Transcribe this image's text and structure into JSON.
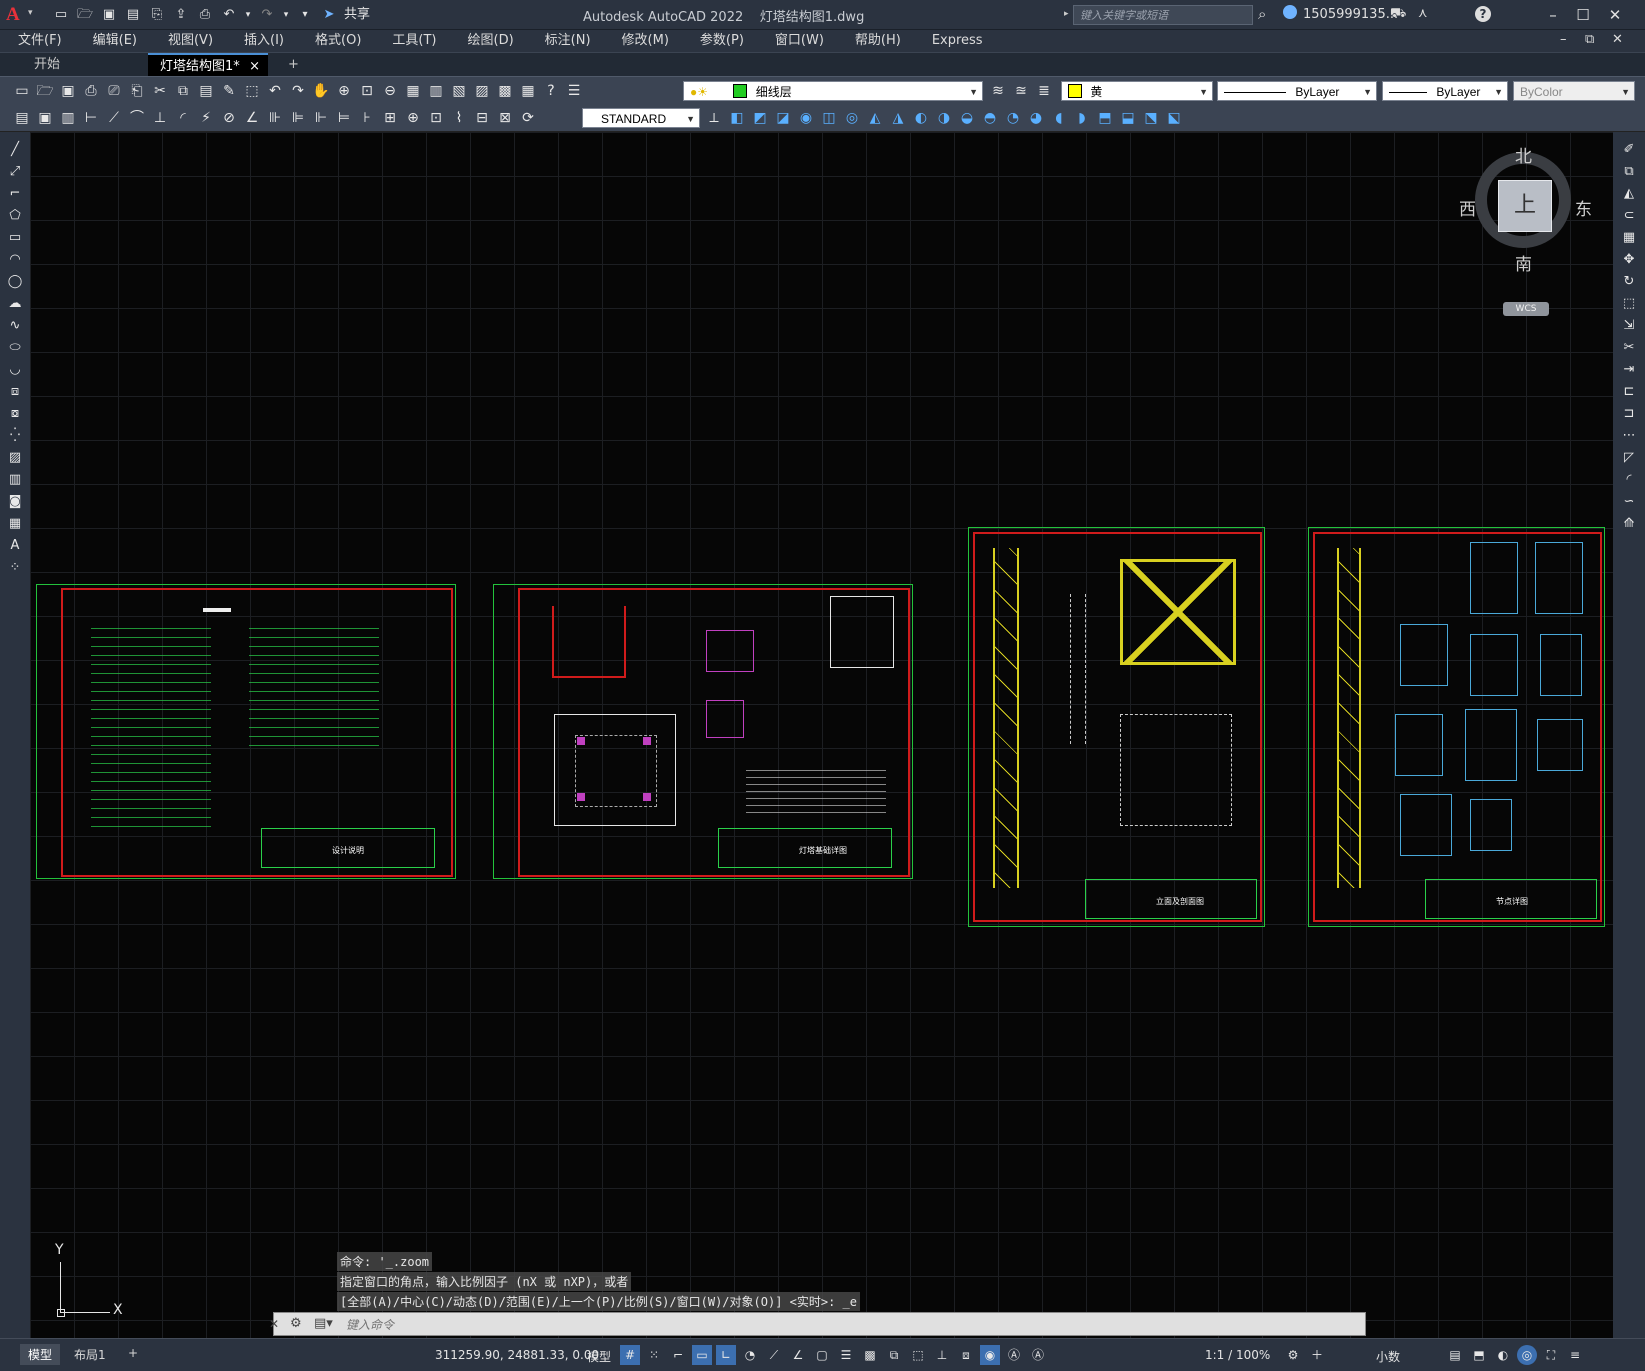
{
  "app": {
    "logo": "A",
    "title": "Autodesk AutoCAD 2022    灯塔结构图1.dwg",
    "share": "共享",
    "search_placeholder": "键入关键字或短语",
    "user": "1505999135..."
  },
  "menu": [
    "文件(F)",
    "编辑(E)",
    "视图(V)",
    "插入(I)",
    "格式(O)",
    "工具(T)",
    "绘图(D)",
    "标注(N)",
    "修改(M)",
    "参数(P)",
    "窗口(W)",
    "帮助(H)",
    "Express"
  ],
  "tabs": {
    "start": "开始",
    "drawing": "灯塔结构图1*",
    "close": "×",
    "add": "+"
  },
  "toolbar": {
    "layer": "细线层",
    "color": "黄",
    "linetype": "ByLayer",
    "lineweight": "ByLayer",
    "plotstyle": "ByColor",
    "textstyle": "STANDARD",
    "colors": {
      "layer_swatch": "#22cc22",
      "color_swatch": "#ffff00"
    }
  },
  "viewcube": {
    "north": "北",
    "south": "南",
    "east": "东",
    "west": "西",
    "top": "上",
    "wcs": "WCS"
  },
  "ucs": {
    "x": "X",
    "y": "Y"
  },
  "sheets": [
    {
      "id": "sheet1",
      "title": "设计说明"
    },
    {
      "id": "sheet2",
      "title": "灯塔基础详图"
    },
    {
      "id": "sheet3",
      "title": "立面及剖面图"
    },
    {
      "id": "sheet4",
      "title": "节点详图"
    }
  ],
  "command": {
    "history": [
      "命令: '_.zoom",
      "指定窗口的角点，输入比例因子 (nX 或 nXP)，或者",
      "[全部(A)/中心(C)/动态(D)/范围(E)/上一个(P)/比例(S)/窗口(W)/对象(O)] <实时>: _e"
    ],
    "placeholder": "键入命令"
  },
  "status": {
    "model_tab": "模型",
    "layout_tab": "布局1",
    "add_tab": "+",
    "coords": "311259.90, 24881.33, 0.00",
    "space": "模型",
    "scale": "1:1 / 100%",
    "units": "小数"
  }
}
